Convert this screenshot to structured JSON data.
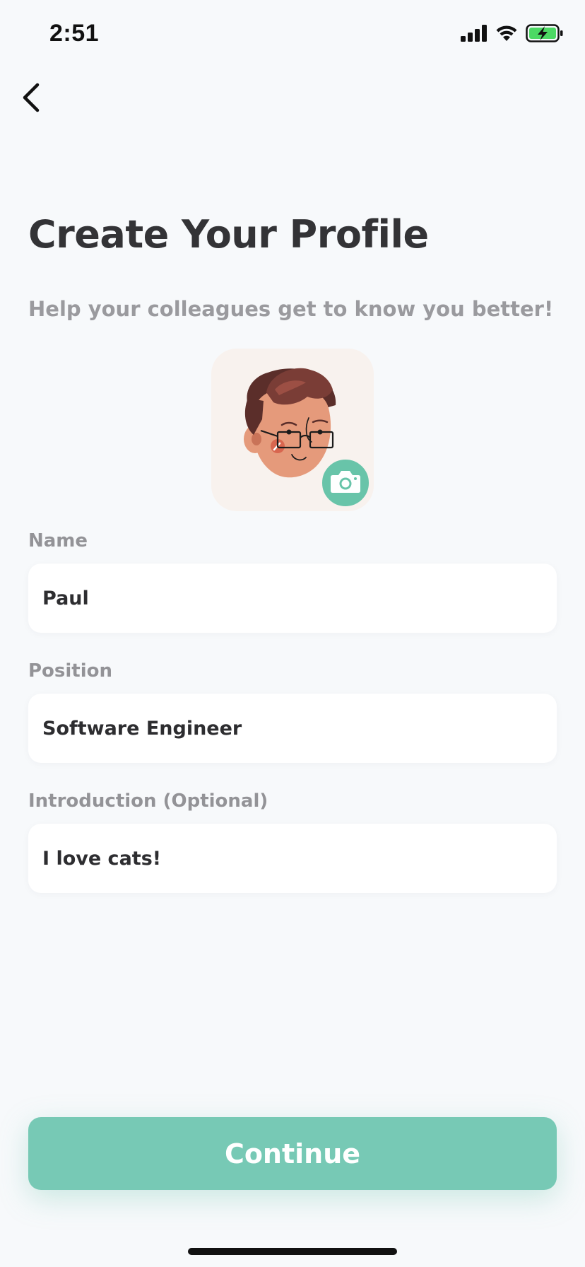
{
  "status_bar": {
    "time": "2:51",
    "icons": [
      "cellular-signal-icon",
      "wifi-icon",
      "battery-charging-icon"
    ]
  },
  "nav": {
    "back_icon": "chevron-left-icon"
  },
  "header": {
    "title": "Create Your Profile",
    "subtitle": "Help your colleagues get to know you better!"
  },
  "avatar": {
    "icon": "cartoon-avatar-with-glasses",
    "camera_icon": "camera-icon"
  },
  "form": {
    "name": {
      "label": "Name",
      "value": "Paul"
    },
    "position": {
      "label": "Position",
      "value": "Software Engineer"
    },
    "introduction": {
      "label": "Introduction (Optional)",
      "value": "I love cats!"
    }
  },
  "actions": {
    "continue_label": "Continue"
  },
  "colors": {
    "background": "#f7f9fb",
    "accent": "#77c9b5",
    "camera_badge": "#68c4a9",
    "avatar_bg": "#f8f2ee",
    "title_text": "#333336",
    "muted_text": "#9a9a9e",
    "battery_fill": "#4cd964"
  }
}
